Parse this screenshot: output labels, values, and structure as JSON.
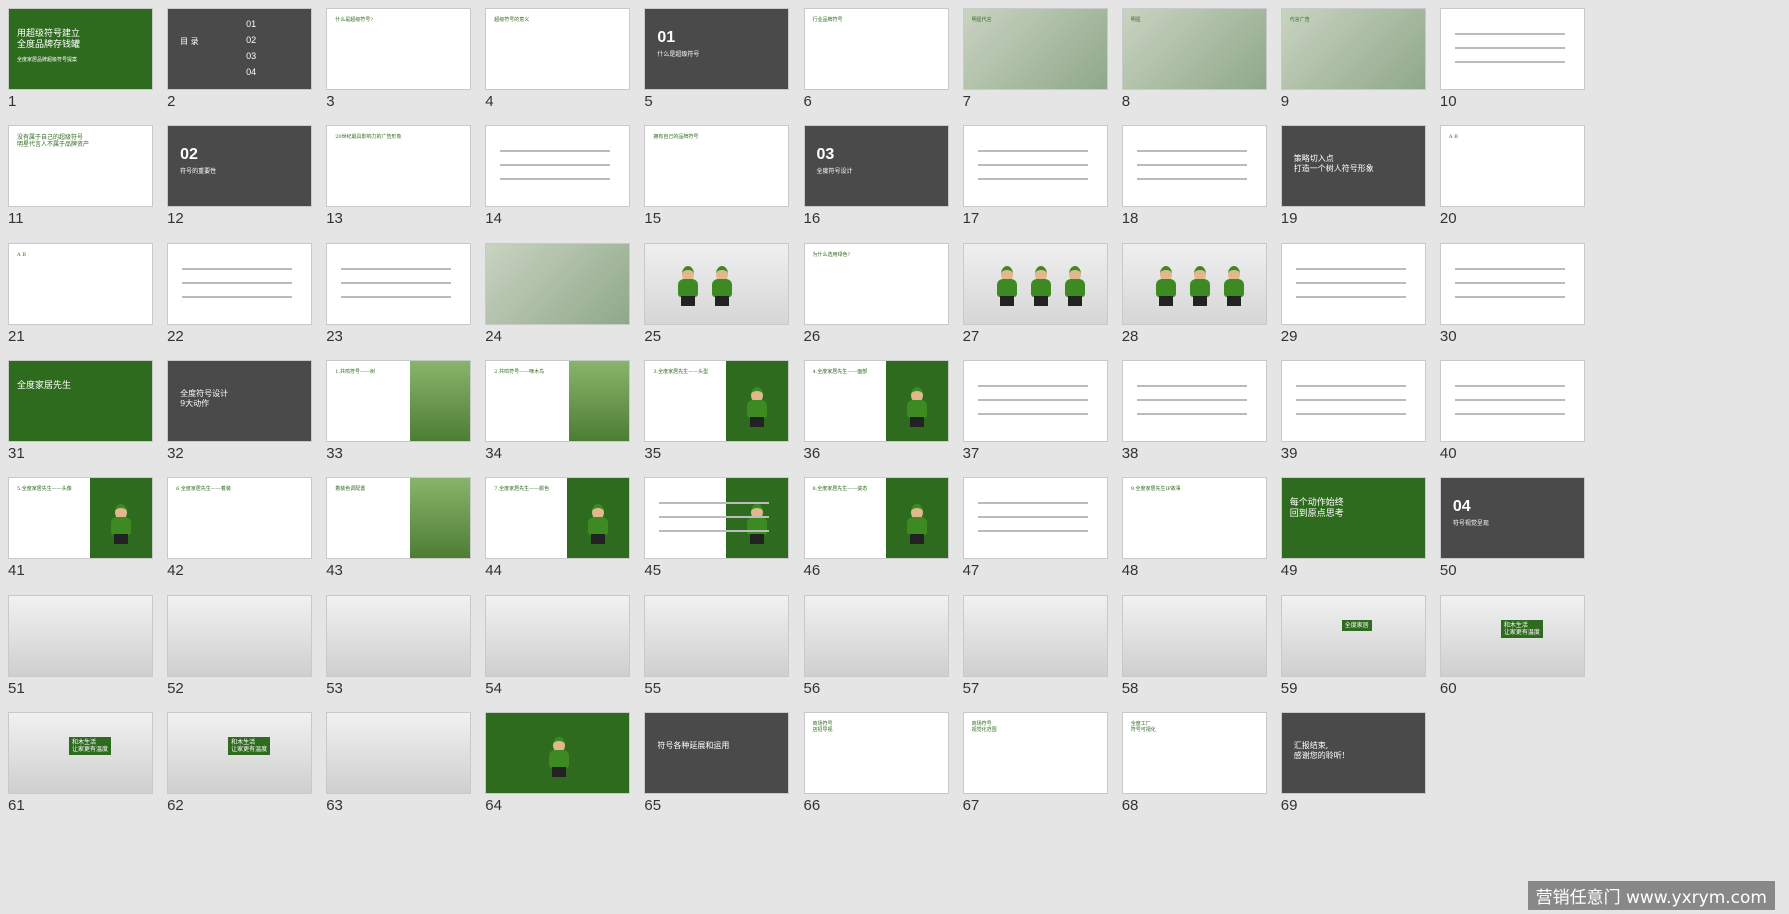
{
  "slides": [
    {
      "n": "1",
      "type": "green",
      "title": "用超级符号建立\n全度品牌存钱罐",
      "sub": "全度家居品牌超级符号提案"
    },
    {
      "n": "2",
      "type": "dark",
      "title": "目 录",
      "items": [
        "01",
        "02",
        "03",
        "04"
      ]
    },
    {
      "n": "3",
      "type": "white",
      "title": "什么是超级符号?"
    },
    {
      "n": "4",
      "type": "white",
      "title": "超级符号的意义"
    },
    {
      "n": "5",
      "type": "dark",
      "big": "01",
      "sub": "什么是超级符号"
    },
    {
      "n": "6",
      "type": "white",
      "title": "行业品牌符号"
    },
    {
      "n": "7",
      "type": "photo",
      "title": "明星代言"
    },
    {
      "n": "8",
      "type": "photo",
      "title": "明星"
    },
    {
      "n": "9",
      "type": "photo",
      "title": "代言广告"
    },
    {
      "n": "10",
      "type": "white",
      "title": ""
    },
    {
      "n": "11",
      "type": "white",
      "title": "没有属于自己的超级符号\n明星代言人不属于品牌资产"
    },
    {
      "n": "12",
      "type": "dark",
      "big": "02",
      "sub": "符号的重要性"
    },
    {
      "n": "13",
      "type": "white",
      "title": "20世纪最具影响力的广告形象"
    },
    {
      "n": "14",
      "type": "white",
      "title": ""
    },
    {
      "n": "15",
      "type": "white",
      "title": "拥有自己的品牌符号"
    },
    {
      "n": "16",
      "type": "dark",
      "big": "03",
      "sub": "全度符号设计"
    },
    {
      "n": "17",
      "type": "white",
      "title": ""
    },
    {
      "n": "18",
      "type": "white",
      "title": ""
    },
    {
      "n": "19",
      "type": "dark",
      "title": "策略切入点\n打造一个树人符号形象"
    },
    {
      "n": "20",
      "type": "white",
      "title": "A B"
    },
    {
      "n": "21",
      "type": "white",
      "title": "A B"
    },
    {
      "n": "22",
      "type": "white",
      "title": ""
    },
    {
      "n": "23",
      "type": "white",
      "title": ""
    },
    {
      "n": "24",
      "type": "photo",
      "title": ""
    },
    {
      "n": "25",
      "type": "mascot",
      "title": ""
    },
    {
      "n": "26",
      "type": "white",
      "title": "为什么选用绿色?"
    },
    {
      "n": "27",
      "type": "mascot",
      "title": ""
    },
    {
      "n": "28",
      "type": "mascot",
      "title": ""
    },
    {
      "n": "29",
      "type": "white",
      "title": ""
    },
    {
      "n": "30",
      "type": "white",
      "title": ""
    },
    {
      "n": "31",
      "type": "green",
      "title": "全度家居先生",
      "sub": ""
    },
    {
      "n": "32",
      "type": "dark",
      "title": "全度符号设计\n9大动作"
    },
    {
      "n": "33",
      "type": "white",
      "title": "1.共鸣符号——树"
    },
    {
      "n": "34",
      "type": "white",
      "title": "2.共鸣符号——啄木鸟"
    },
    {
      "n": "35",
      "type": "white",
      "title": "3.全度家居先生——头型"
    },
    {
      "n": "36",
      "type": "white",
      "title": "4.全度家居先生——面部"
    },
    {
      "n": "37",
      "type": "white",
      "title": ""
    },
    {
      "n": "38",
      "type": "white",
      "title": ""
    },
    {
      "n": "39",
      "type": "white",
      "title": ""
    },
    {
      "n": "40",
      "type": "white",
      "title": ""
    },
    {
      "n": "41",
      "type": "white",
      "title": "5.全度家居先生——头像"
    },
    {
      "n": "42",
      "type": "white",
      "title": "6.全度家居先生——着装"
    },
    {
      "n": "43",
      "type": "white",
      "title": "着装色调配置"
    },
    {
      "n": "44",
      "type": "white",
      "title": "7.全度家居先生——颜色"
    },
    {
      "n": "45",
      "type": "white",
      "title": ""
    },
    {
      "n": "46",
      "type": "white",
      "title": "8.全度家居先生——姿态"
    },
    {
      "n": "47",
      "type": "white",
      "title": ""
    },
    {
      "n": "48",
      "type": "white",
      "title": "9.全度家居先生IP故事"
    },
    {
      "n": "49",
      "type": "green",
      "title": "每个动作始终\n回到原点思考",
      "sub": ""
    },
    {
      "n": "50",
      "type": "dark",
      "big": "04",
      "sub": "符号视觉呈现"
    },
    {
      "n": "51",
      "type": "mockup",
      "title": ""
    },
    {
      "n": "52",
      "type": "mockup",
      "title": ""
    },
    {
      "n": "53",
      "type": "mockup",
      "title": ""
    },
    {
      "n": "54",
      "type": "mockup",
      "title": ""
    },
    {
      "n": "55",
      "type": "mockup",
      "title": ""
    },
    {
      "n": "56",
      "type": "mockup",
      "title": ""
    },
    {
      "n": "57",
      "type": "mockup",
      "title": ""
    },
    {
      "n": "58",
      "type": "mockup",
      "title": ""
    },
    {
      "n": "59",
      "type": "mockup",
      "title": "全度家居"
    },
    {
      "n": "60",
      "type": "mockup",
      "title": "和木生活\n让家更有温度"
    },
    {
      "n": "61",
      "type": "mockup",
      "title": "和木生活\n让家更有温度"
    },
    {
      "n": "62",
      "type": "mockup",
      "title": "和木生活\n让家更有温度"
    },
    {
      "n": "63",
      "type": "mockup",
      "title": ""
    },
    {
      "n": "64",
      "type": "green",
      "title": "",
      "sub": ""
    },
    {
      "n": "65",
      "type": "dark",
      "title": "符号各种延展和运用"
    },
    {
      "n": "66",
      "type": "white",
      "title": "商场符号\n店招导视"
    },
    {
      "n": "67",
      "type": "white",
      "title": "商场符号\n视觉化范围"
    },
    {
      "n": "68",
      "type": "white",
      "title": "全度工厂\n符号可视化"
    },
    {
      "n": "69",
      "type": "dark",
      "title": "汇报结束,\n感谢您的聆听!"
    }
  ],
  "watermark": "营销任意门 www.yxrym.com"
}
